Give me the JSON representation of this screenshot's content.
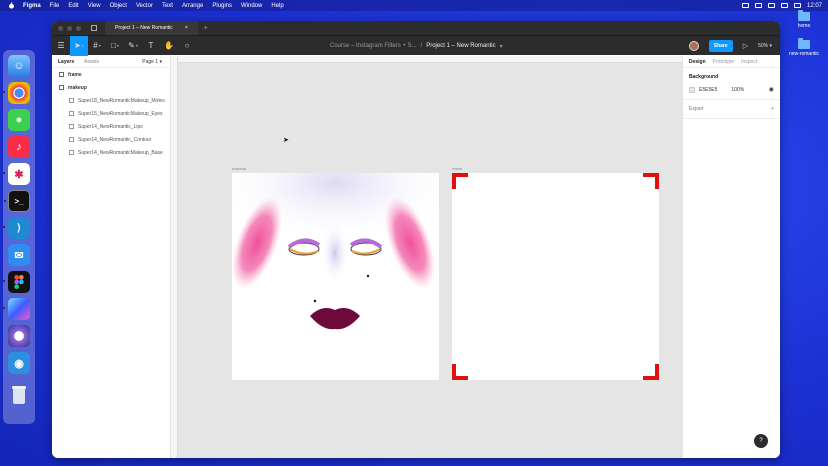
{
  "menubar": {
    "app_name": "Figma",
    "items": [
      "File",
      "Edit",
      "View",
      "Object",
      "Vector",
      "Text",
      "Arrange",
      "Plugins",
      "Window",
      "Help"
    ],
    "clock": "12:07"
  },
  "desktop": {
    "folders": [
      "home",
      "new-romantic"
    ]
  },
  "window": {
    "tab_title": "Project 1 – New Romantic",
    "file_path_parent": "Course – Instagram Filters + S...",
    "file_path_sep": "/",
    "file_path_current": "Project 1 – New Romantic",
    "share_label": "Share",
    "zoom_label": "50%"
  },
  "left_panel": {
    "tab_layers": "Layers",
    "tab_assets": "Assets",
    "page_label": "Page 1",
    "layers": [
      {
        "name": "frame",
        "level": 0
      },
      {
        "name": "makeup",
        "level": 0
      },
      {
        "name": "Super18_NewRomanticMakeup_Moles",
        "level": 1
      },
      {
        "name": "Super15_NewRomanticMakeup_Eyes",
        "level": 1
      },
      {
        "name": "Super14_NewRomantic_Lips",
        "level": 1
      },
      {
        "name": "Super14_NewRomantic_Contour",
        "level": 1
      },
      {
        "name": "Super14_NewRomanticMakeup_Base",
        "level": 1
      }
    ]
  },
  "canvas": {
    "frame1_label": "makeup",
    "frame2_label": "frame"
  },
  "right_panel": {
    "tab_design": "Design",
    "tab_prototype": "Prototype",
    "tab_inspect": "Inspect",
    "background_heading": "Background",
    "background_hex": "E5E5E5",
    "background_opacity": "100%",
    "export_label": "Export",
    "help": "?"
  },
  "colors": {
    "accent": "#0d99ff",
    "canvas_bg": "#e5e5e5",
    "corner_red": "#e01010",
    "blush_pink": "#f0509a",
    "lip_color": "#6e0a3a"
  }
}
